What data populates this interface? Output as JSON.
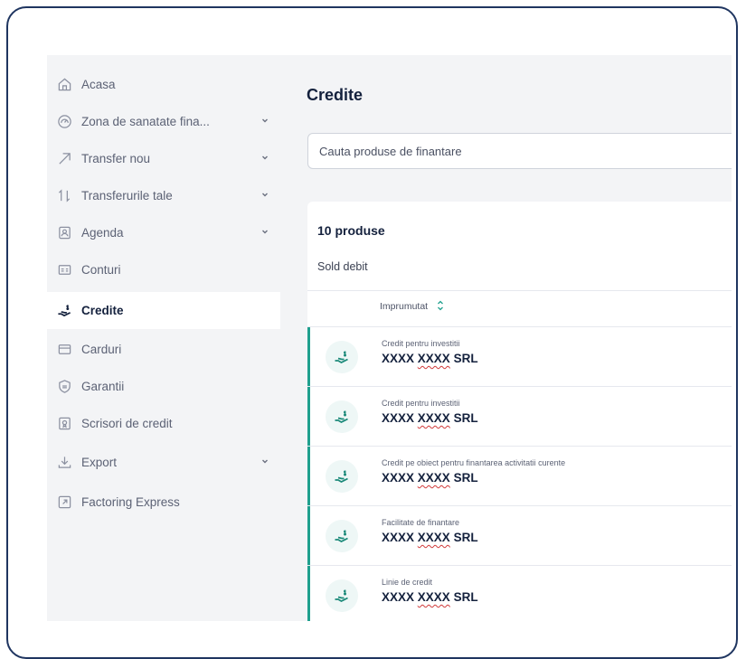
{
  "sidebar": {
    "items": [
      {
        "label": "Acasa",
        "icon": "home-icon",
        "chevron": false,
        "active": false
      },
      {
        "label": "Zona de sanatate fina...",
        "icon": "gauge-icon",
        "chevron": true,
        "active": false
      },
      {
        "label": "Transfer nou",
        "icon": "arrow-up-right-icon",
        "chevron": true,
        "active": false
      },
      {
        "label": "Transferurile tale",
        "icon": "transfer-arrows-icon",
        "chevron": true,
        "active": false
      },
      {
        "label": "Agenda",
        "icon": "contact-book-icon",
        "chevron": true,
        "active": false
      },
      {
        "label": "Conturi",
        "icon": "accounts-icon",
        "chevron": false,
        "active": false
      },
      {
        "label": "Credite",
        "icon": "credit-hand-icon",
        "chevron": false,
        "active": true
      },
      {
        "label": "Carduri",
        "icon": "card-icon",
        "chevron": false,
        "active": false
      },
      {
        "label": "Garantii",
        "icon": "shield-icon",
        "chevron": false,
        "active": false
      },
      {
        "label": "Scrisori de credit",
        "icon": "letter-icon",
        "chevron": false,
        "active": false
      },
      {
        "label": "Export",
        "icon": "download-icon",
        "chevron": true,
        "active": false
      },
      {
        "label": "Factoring Express",
        "icon": "external-link-icon",
        "chevron": false,
        "active": false
      }
    ]
  },
  "main": {
    "title": "Credite",
    "search": {
      "placeholder": "Cauta produse de finantare",
      "value": ""
    },
    "count": "10 produse",
    "filter": "Sold debit",
    "column": "Imprumutat",
    "rows": [
      {
        "type": "Credit pentru investitii",
        "name_prefix": "XXXX ",
        "name_marked": "XXXX",
        "name_suffix": " SRL"
      },
      {
        "type": "Credit pentru investitii",
        "name_prefix": "XXXX ",
        "name_marked": "XXXX",
        "name_suffix": " SRL"
      },
      {
        "type": "Credit pe obiect pentru finantarea activitatii curente",
        "name_prefix": "XXXX ",
        "name_marked": "XXXX",
        "name_suffix": " SRL"
      },
      {
        "type": "Facilitate de finantare",
        "name_prefix": "XXXX ",
        "name_marked": "XXXX",
        "name_suffix": " SRL"
      },
      {
        "type": "Linie de credit",
        "name_prefix": "XXXX ",
        "name_marked": "XXXX",
        "name_suffix": " SRL"
      }
    ]
  },
  "colors": {
    "accent": "#1fa08e",
    "text_dark": "#14213d",
    "sidebar_bg": "#f3f4f6",
    "frame": "#1f3560"
  }
}
